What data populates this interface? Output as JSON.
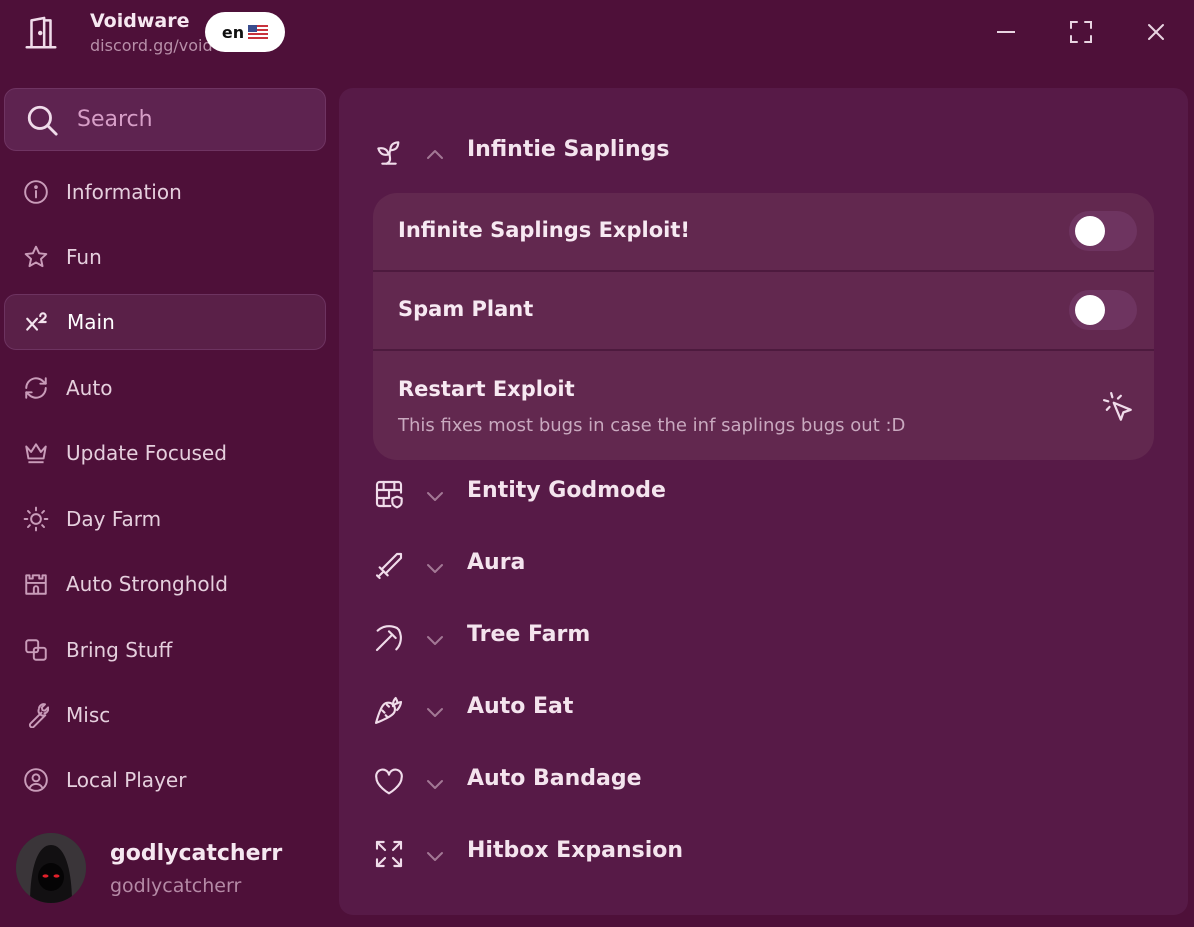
{
  "app": {
    "title": "Voidware",
    "subtitle": "discord.gg/voidware",
    "language": "en"
  },
  "search": {
    "placeholder": "Search"
  },
  "sidebar": {
    "items": [
      {
        "label": "Information",
        "icon": "info-icon"
      },
      {
        "label": "Fun",
        "icon": "star-icon"
      },
      {
        "label": "Main",
        "icon": "superscript-icon",
        "active": true
      },
      {
        "label": "Auto",
        "icon": "refresh-icon"
      },
      {
        "label": "Update Focused",
        "icon": "crown-icon"
      },
      {
        "label": "Day Farm",
        "icon": "sun-icon"
      },
      {
        "label": "Auto Stronghold",
        "icon": "castle-icon"
      },
      {
        "label": "Bring Stuff",
        "icon": "copy-icon"
      },
      {
        "label": "Misc",
        "icon": "wrench-icon"
      },
      {
        "label": "Local Player",
        "icon": "user-circle-icon"
      }
    ]
  },
  "profile": {
    "display_name": "godlycatcherr",
    "username": "godlycatcherr"
  },
  "content": {
    "sections": [
      {
        "title": "Infintie Saplings",
        "icon": "sprout-icon",
        "expanded": true,
        "rows": [
          {
            "label": "Infinite Saplings Exploit!",
            "type": "toggle",
            "value": false
          },
          {
            "label": "Spam Plant",
            "type": "toggle",
            "value": false
          },
          {
            "label": "Restart Exploit",
            "type": "button",
            "description": "This fixes most bugs in case the inf saplings bugs out :D"
          }
        ]
      },
      {
        "title": "Entity Godmode",
        "icon": "brick-wall-shield-icon",
        "expanded": false
      },
      {
        "title": "Aura",
        "icon": "sword-icon",
        "expanded": false
      },
      {
        "title": "Tree Farm",
        "icon": "pickaxe-icon",
        "expanded": false
      },
      {
        "title": "Auto Eat",
        "icon": "carrot-icon",
        "expanded": false
      },
      {
        "title": "Auto Bandage",
        "icon": "heart-icon",
        "expanded": false
      },
      {
        "title": "Hitbox Expansion",
        "icon": "expand-icon",
        "expanded": false
      }
    ]
  },
  "colors": {
    "background": "#4e1039",
    "panel": "#571a47",
    "card": "#62284f",
    "accent_text": "#d79ec7"
  }
}
